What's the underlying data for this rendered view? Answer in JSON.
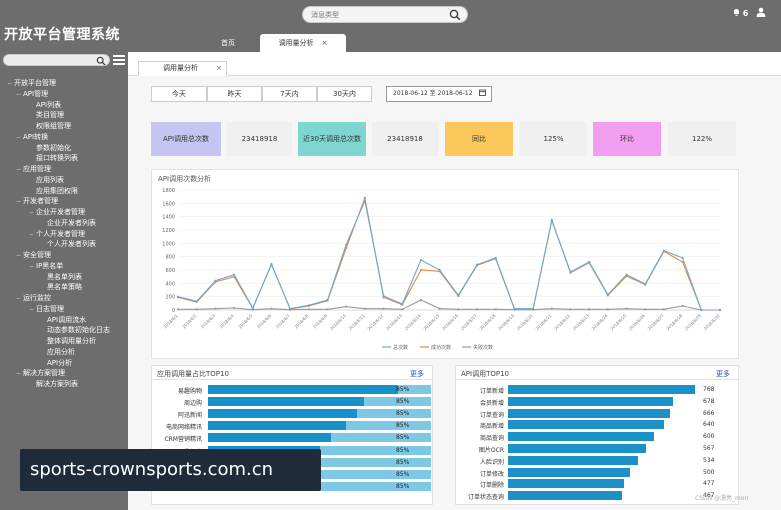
{
  "app": {
    "title": "开放平台管理系统"
  },
  "header": {
    "search_placeholder": "消息类型",
    "bell_label": "6",
    "tabs": [
      {
        "label": "首页",
        "active": false
      },
      {
        "label": "调用量分析",
        "active": true,
        "close": "×"
      }
    ]
  },
  "sidebar": {
    "items": [
      {
        "label": "开放平台管理",
        "mark": "−"
      },
      {
        "label": "API管理",
        "mark": "−"
      },
      {
        "label": "API列表",
        "mark": ""
      },
      {
        "label": "类目管理",
        "mark": ""
      },
      {
        "label": "权限组管理",
        "mark": ""
      },
      {
        "label": "API转换",
        "mark": "−"
      },
      {
        "label": "参数初始化",
        "mark": ""
      },
      {
        "label": "接口转换列表",
        "mark": ""
      },
      {
        "label": "应用管理",
        "mark": "−"
      },
      {
        "label": "应用列表",
        "mark": ""
      },
      {
        "label": "应用集团权限",
        "mark": ""
      },
      {
        "label": "开发者管理",
        "mark": "−"
      },
      {
        "label": "企业开发者管理",
        "mark": "−"
      },
      {
        "label": "企业开发者列表",
        "mark": ""
      },
      {
        "label": "个人开发者管理",
        "mark": "−"
      },
      {
        "label": "个人开发者列表",
        "mark": ""
      },
      {
        "label": "安全管理",
        "mark": "−"
      },
      {
        "label": "IP黑名单",
        "mark": "−"
      },
      {
        "label": "黑名单列表",
        "mark": ""
      },
      {
        "label": "黑名单策略",
        "mark": ""
      },
      {
        "label": "运行监控",
        "mark": "−"
      },
      {
        "label": "日志管理",
        "mark": "−"
      },
      {
        "label": "API调用流水",
        "mark": ""
      },
      {
        "label": "动态参数初始化日志",
        "mark": ""
      },
      {
        "label": "整体调用量分析",
        "mark": ""
      },
      {
        "label": "应用分析",
        "mark": ""
      },
      {
        "label": "API分析",
        "mark": ""
      },
      {
        "label": "解决方案管理",
        "mark": "−"
      },
      {
        "label": "解决方案列表",
        "mark": ""
      }
    ]
  },
  "page": {
    "tab_label": "调用量分析",
    "tab_close": "×",
    "quick_ranges": [
      "今天",
      "昨天",
      "7天内",
      "30天内"
    ],
    "date_range": "2018-06-12 至 2018-06-12",
    "stats": [
      {
        "label": "API调用总次数",
        "value": "23418918",
        "color": "#c6c4f0"
      },
      {
        "label": "近30天调用总次数",
        "value": "23418918",
        "color": "#7fd6d0"
      },
      {
        "label": "同比",
        "value": "125%",
        "color": "#fcc75b"
      },
      {
        "label": "环比",
        "value": "122%",
        "color": "#f19ef0"
      }
    ],
    "stat_value_bg": "#f0f0f0"
  },
  "chart_data": {
    "type": "line",
    "title": "API调用次数分析",
    "ylim": [
      0,
      1800
    ],
    "yticks": [
      0,
      200,
      400,
      600,
      800,
      1000,
      1200,
      1400,
      1600,
      1800
    ],
    "x": [
      "2018/6/1",
      "2018/6/2",
      "2018/6/3",
      "2018/6/4",
      "2018/6/5",
      "2018/6/6",
      "2018/6/7",
      "2018/6/8",
      "2018/6/9",
      "2018/6/10",
      "2018/6/11",
      "2018/6/12",
      "2018/6/13",
      "2018/6/14",
      "2018/6/15",
      "2018/6/16",
      "2018/6/17",
      "2018/6/18",
      "2018/6/19",
      "2018/6/20",
      "2018/6/21",
      "2018/6/22",
      "2018/6/23",
      "2018/6/24",
      "2018/6/25",
      "2018/6/26",
      "2018/6/27",
      "2018/6/28",
      "2018/6/29",
      "2018/6/30"
    ],
    "series": [
      {
        "name": "总次数",
        "color": "#6ba6d6",
        "values": [
          200,
          130,
          440,
          530,
          30,
          680,
          20,
          70,
          150,
          980,
          1640,
          210,
          90,
          750,
          600,
          220,
          680,
          780,
          20,
          20,
          1340,
          570,
          720,
          230,
          530,
          390,
          890,
          780,
          0,
          0
        ]
      },
      {
        "name": "成功次数",
        "color": "#e58a3c",
        "values": [
          190,
          120,
          420,
          500,
          25,
          690,
          15,
          60,
          140,
          930,
          1680,
          190,
          80,
          600,
          580,
          210,
          670,
          770,
          15,
          15,
          1350,
          560,
          710,
          220,
          510,
          380,
          880,
          720,
          0,
          0
        ]
      },
      {
        "name": "失败次数",
        "color": "#999999",
        "values": [
          10,
          10,
          20,
          30,
          5,
          20,
          5,
          10,
          10,
          50,
          20,
          20,
          10,
          150,
          20,
          10,
          10,
          10,
          5,
          5,
          20,
          10,
          10,
          10,
          20,
          10,
          10,
          60,
          0,
          0
        ]
      }
    ],
    "legend": "bottom",
    "grid": true
  },
  "top_apps": {
    "title": "应用调用量占比TOP10",
    "more": "更多",
    "rows": [
      {
        "label": "易趣购物",
        "pct": "85%",
        "fill": 0.85
      },
      {
        "label": "周边购",
        "pct": "85%",
        "fill": 0.7
      },
      {
        "label": "阿迅新闻",
        "pct": "85%",
        "fill": 0.67
      },
      {
        "label": "电商网络精讯",
        "pct": "85%",
        "fill": 0.62
      },
      {
        "label": "CRM营销精讯",
        "pct": "85%",
        "fill": 0.55
      },
      {
        "label": "易趣好省",
        "pct": "85%",
        "fill": 0.5
      },
      {
        "label": "智慧终端",
        "pct": "85%",
        "fill": 0.45
      },
      {
        "label": "云管理",
        "pct": "85%",
        "fill": 0.4
      },
      {
        "label": "阿迅新闻",
        "pct": "85%",
        "fill": 0.36
      }
    ]
  },
  "top_apis": {
    "title": "API调用TOP10",
    "more": "更多",
    "rows": [
      {
        "label": "订单新增",
        "value": "768"
      },
      {
        "label": "会员新增",
        "value": "678"
      },
      {
        "label": "订单查询",
        "value": "666"
      },
      {
        "label": "商品新增",
        "value": "640"
      },
      {
        "label": "商品查询",
        "value": "600"
      },
      {
        "label": "图片OCR",
        "value": "567"
      },
      {
        "label": "人脸识别",
        "value": "534"
      },
      {
        "label": "订单修改",
        "value": "500"
      },
      {
        "label": "订单删除",
        "value": "477"
      },
      {
        "label": "订单状态查询",
        "value": "467"
      }
    ],
    "max": 800
  },
  "watermark": {
    "text": "sports-crownsports.com.cn"
  },
  "credit": {
    "text": "CSDN @漂亮_mon"
  }
}
